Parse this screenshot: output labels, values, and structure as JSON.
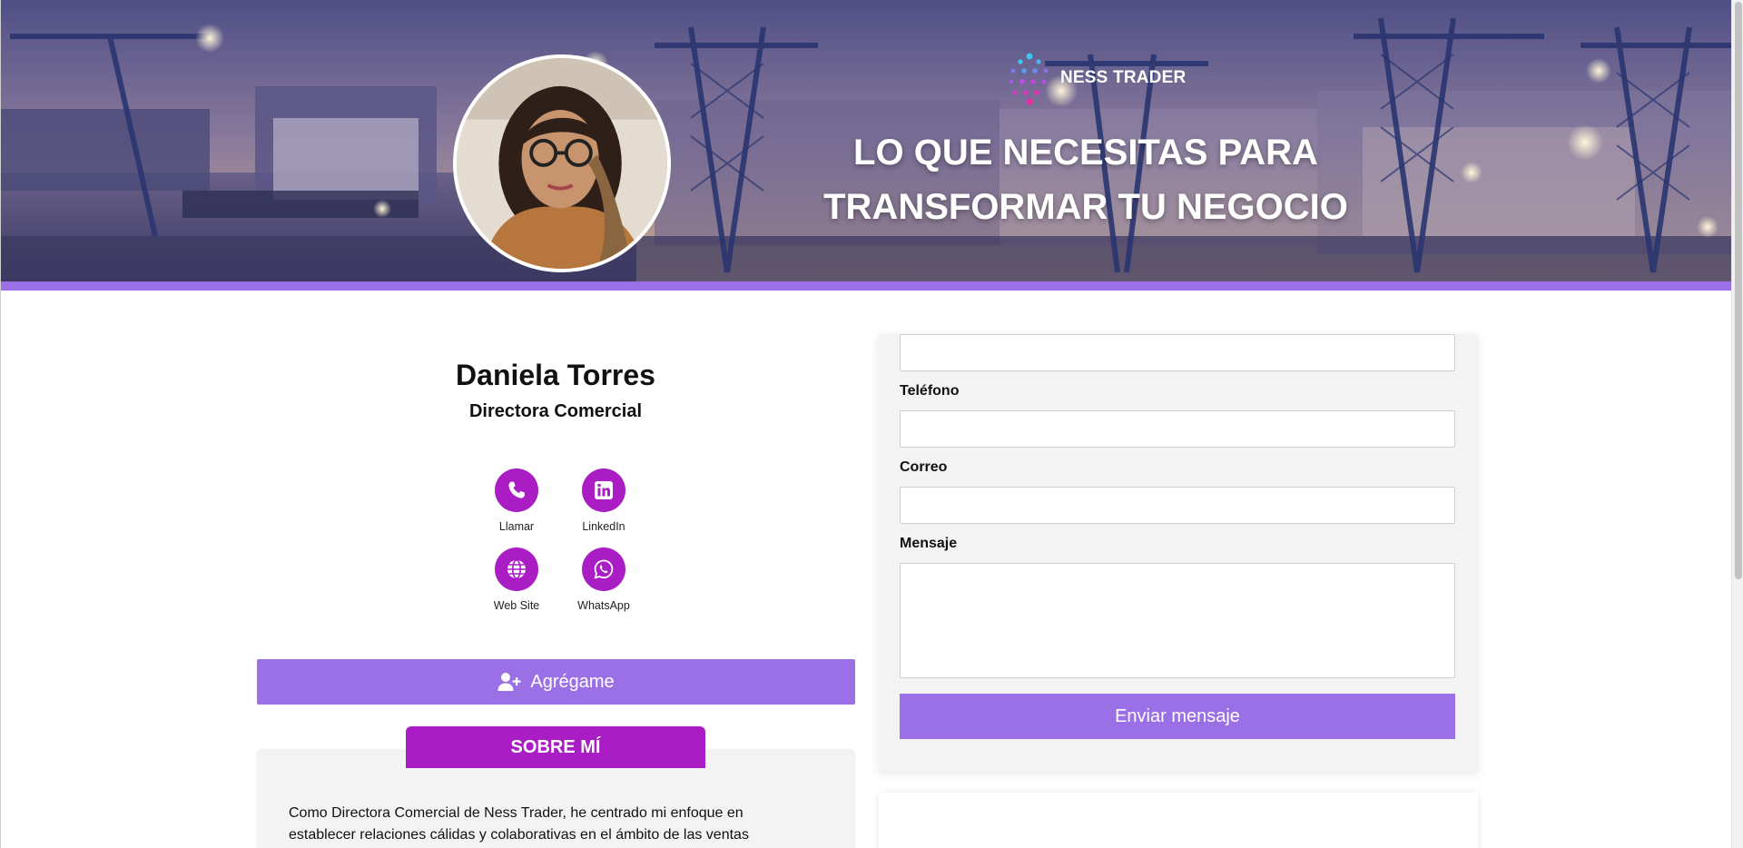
{
  "hero": {
    "brand_name": "NESS TRADER",
    "title_line1": "LO QUE NECESITAS PARA",
    "title_line2": "TRANSFORMAR TU NEGOCIO",
    "accent_bar_color": "#9b6fe6"
  },
  "profile": {
    "name": "Daniela Torres",
    "role": "Directora Comercial"
  },
  "actions": [
    {
      "label": "Llamar",
      "icon": "phone-icon"
    },
    {
      "label": "LinkedIn",
      "icon": "linkedin-icon"
    },
    {
      "label": "Web Site",
      "icon": "globe-icon"
    },
    {
      "label": "WhatsApp",
      "icon": "whatsapp-icon"
    }
  ],
  "add_contact": {
    "label": "Agrégame",
    "icon": "user-plus-icon"
  },
  "about": {
    "tab_label": "SOBRE MÍ",
    "text_line1": "Como Directora Comercial de Ness Trader, he centrado mi enfoque en",
    "text_line2": "establecer relaciones cálidas y colaborativas en el ámbito de las ventas"
  },
  "contact_form": {
    "name_value": "",
    "phone_label": "Teléfono",
    "phone_value": "",
    "email_label": "Correo",
    "email_value": "",
    "message_label": "Mensaje",
    "message_value": "",
    "submit_label": "Enviar mensaje"
  },
  "colors": {
    "primary": "#9b6fe6",
    "accent": "#aa1cc4",
    "card_bg": "#f3f3f3"
  }
}
